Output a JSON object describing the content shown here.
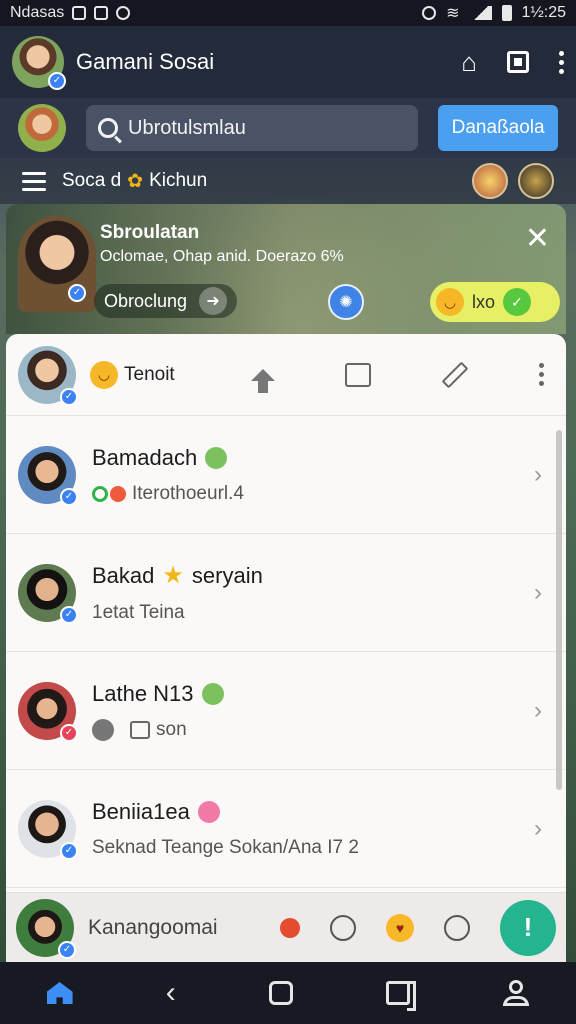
{
  "status_bar": {
    "carrier": "Ndasas",
    "time": "1½:25"
  },
  "app_bar": {
    "title": "Gamani Sosai"
  },
  "search": {
    "value": "Ubrotulsmlau",
    "button_label": "Danaßaola"
  },
  "section": {
    "label": "Soca d",
    "title": "Kichun"
  },
  "profile_card": {
    "name": "Sbroulatan",
    "subtitle": "Oclomae, Ohap anid. Doerazo 6%",
    "chip_label": "Obroclung",
    "react_label": "lxo"
  },
  "chat_panel": {
    "header_label": "Tenoit",
    "conversations": [
      {
        "name": "Bamadach",
        "message": "Iterothoeurl.4"
      },
      {
        "name": "Bakad",
        "name_suffix": "seryain",
        "message": "1etat Teina"
      },
      {
        "name": "Lathe N13",
        "message": "son"
      },
      {
        "name": "Beniia1ea",
        "message": "Seknad Teange Sokan/Ana I7 2"
      }
    ]
  },
  "composer": {
    "placeholder": "Kanangoomai",
    "send_symbol": "!"
  },
  "icons": {
    "app_bar": [
      "home-icon",
      "square-icon",
      "more-vertical-icon"
    ],
    "bottom_nav": [
      "home-icon",
      "back-icon",
      "square-icon",
      "recents-icon",
      "user-icon"
    ]
  },
  "colors": {
    "accent": "#4a9ff0",
    "fab": "#24b58f",
    "app_bar": "#232a3a"
  }
}
